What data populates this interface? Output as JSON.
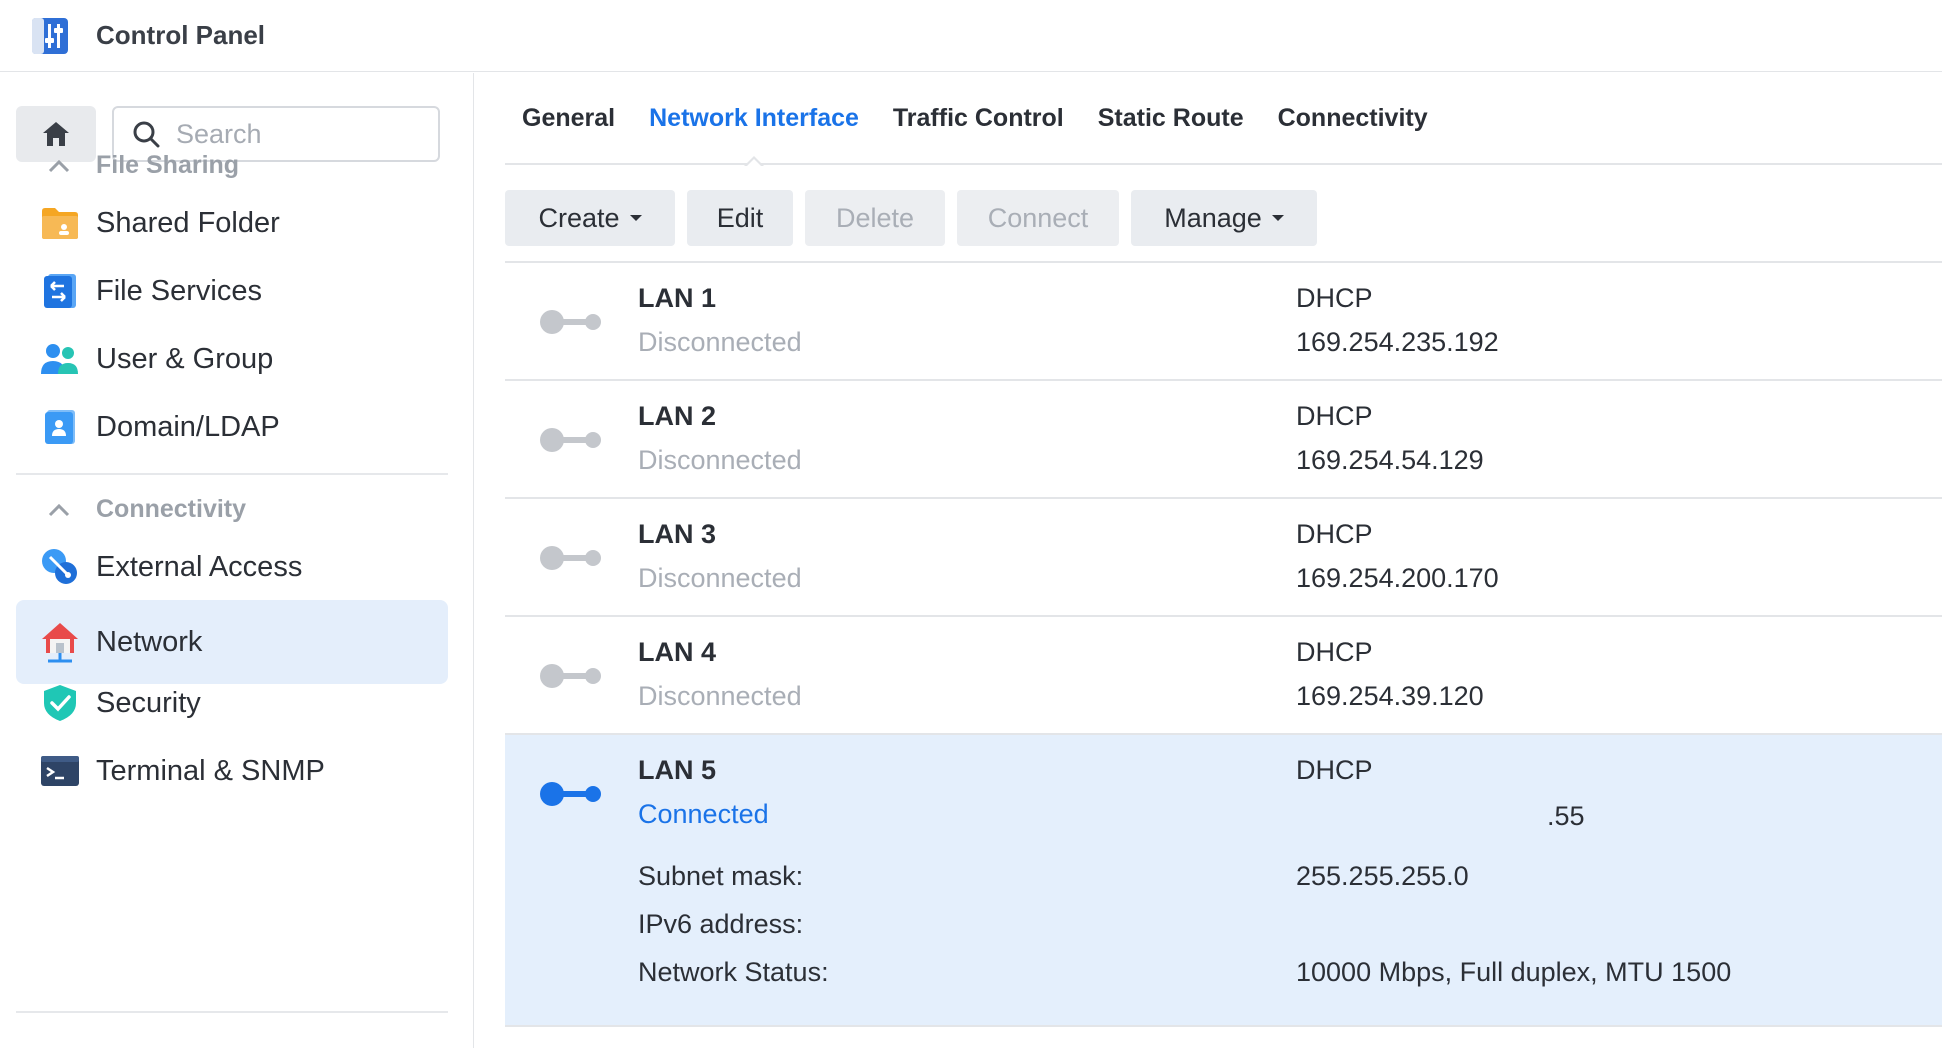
{
  "window": {
    "title": "Control Panel"
  },
  "sidebar": {
    "search_placeholder": "Search",
    "groups": [
      {
        "label": "File Sharing"
      },
      {
        "label": "Connectivity"
      }
    ],
    "items": [
      {
        "label": "Shared Folder",
        "icon": "folder-icon"
      },
      {
        "label": "File Services",
        "icon": "file-services-icon"
      },
      {
        "label": "User & Group",
        "icon": "users-icon"
      },
      {
        "label": "Domain/LDAP",
        "icon": "domain-icon"
      },
      {
        "label": "External Access",
        "icon": "external-access-icon"
      },
      {
        "label": "Network",
        "icon": "network-house-icon",
        "active": true
      },
      {
        "label": "Security",
        "icon": "shield-icon"
      },
      {
        "label": "Terminal & SNMP",
        "icon": "terminal-icon"
      }
    ]
  },
  "tabs": [
    {
      "label": "General"
    },
    {
      "label": "Network Interface",
      "active": true
    },
    {
      "label": "Traffic Control"
    },
    {
      "label": "Static Route"
    },
    {
      "label": "Connectivity"
    }
  ],
  "toolbar": {
    "create": "Create",
    "edit": "Edit",
    "delete": "Delete",
    "connect": "Connect",
    "manage": "Manage"
  },
  "interfaces": [
    {
      "name": "LAN 1",
      "status": "Disconnected",
      "mode": "DHCP",
      "ip": "169.254.235.192"
    },
    {
      "name": "LAN 2",
      "status": "Disconnected",
      "mode": "DHCP",
      "ip": "169.254.54.129"
    },
    {
      "name": "LAN 3",
      "status": "Disconnected",
      "mode": "DHCP",
      "ip": "169.254.200.170"
    },
    {
      "name": "LAN 4",
      "status": "Disconnected",
      "mode": "DHCP",
      "ip": "169.254.39.120"
    },
    {
      "name": "LAN 5",
      "status": "Connected",
      "mode": "DHCP",
      "ip": ".55",
      "details": {
        "subnet_label": "Subnet mask:",
        "subnet_value": "255.255.255.0",
        "ipv6_label": "IPv6 address:",
        "ipv6_value": "",
        "netstatus_label": "Network Status:",
        "netstatus_value": "10000 Mbps, Full duplex, MTU 1500"
      }
    }
  ],
  "colors": {
    "accent": "#1a73e8",
    "disconnected": "#c4c7cc",
    "selected_row": "#e4effc"
  }
}
